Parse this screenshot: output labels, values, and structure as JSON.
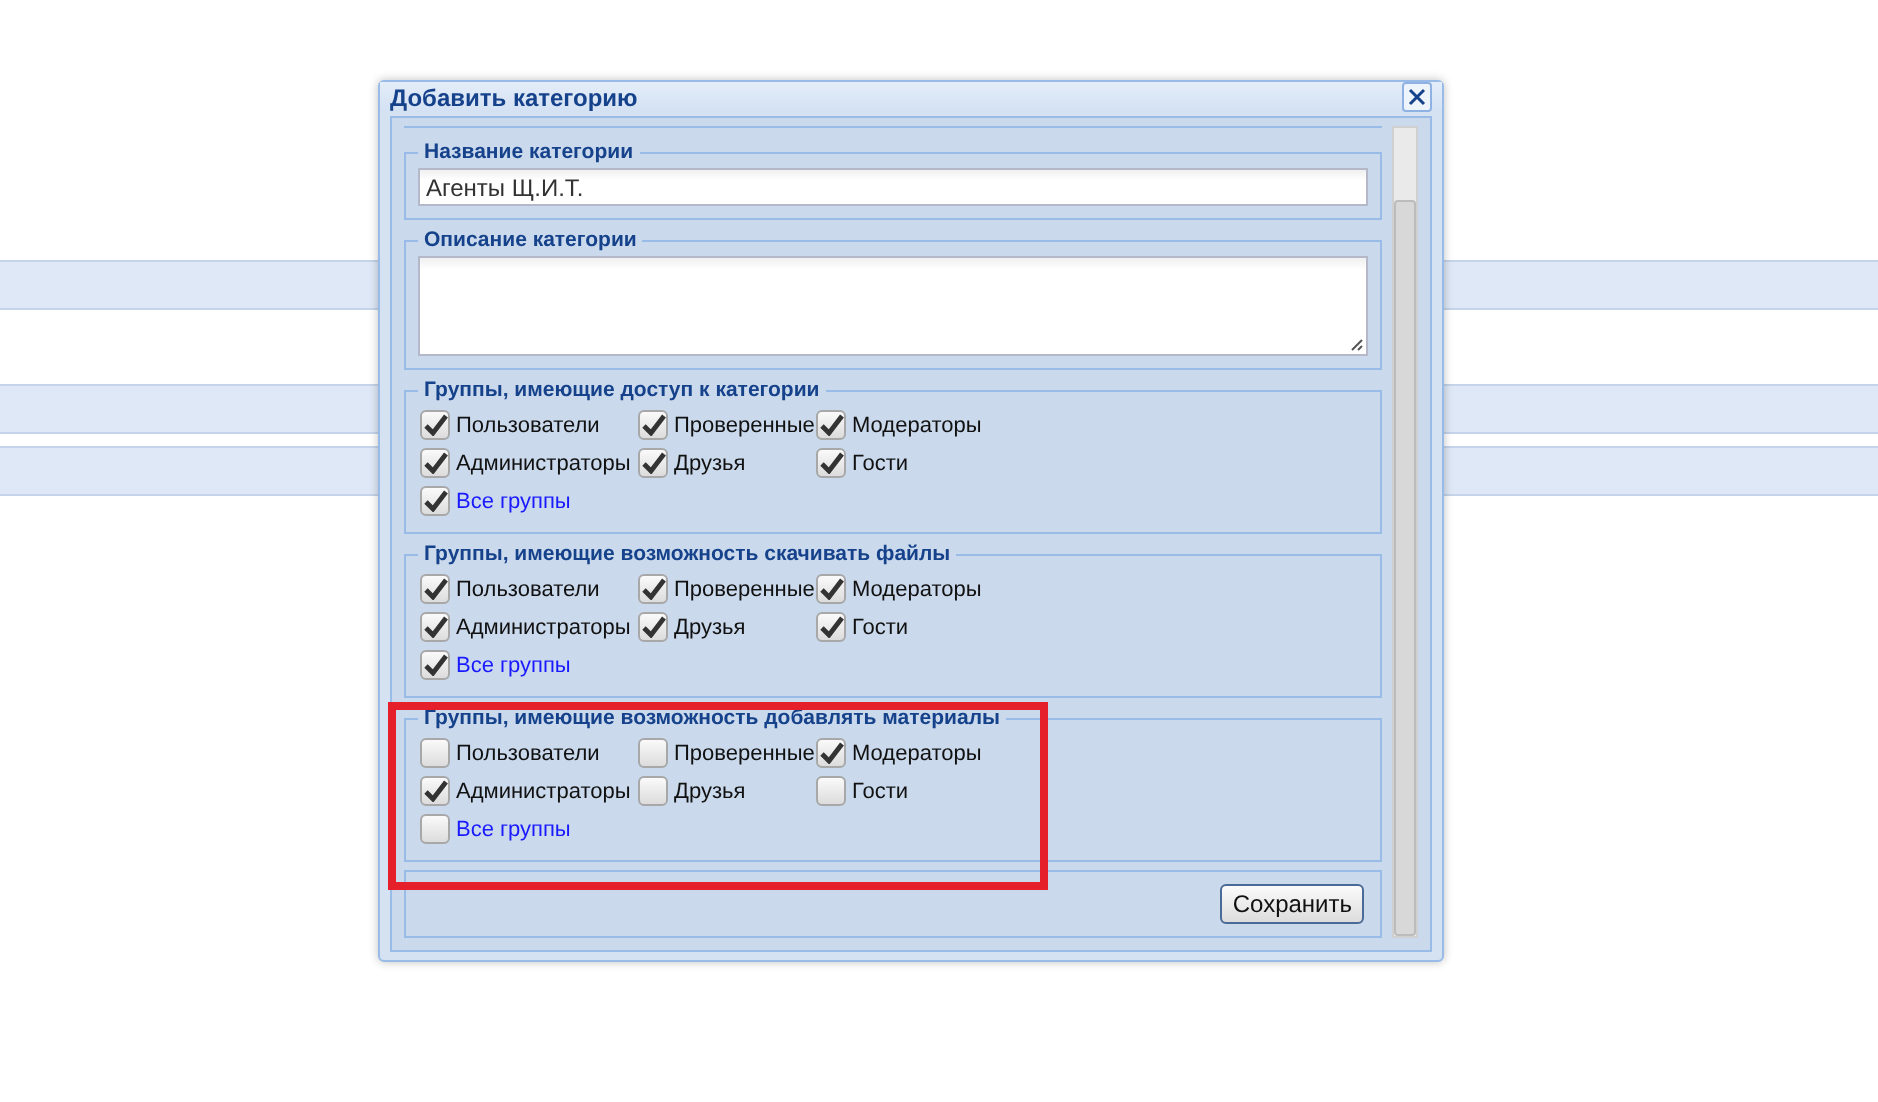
{
  "window": {
    "title": "Добавить категорию"
  },
  "sections": [
    {
      "kind": "text_field",
      "title": "Название категории",
      "value": "Агенты Щ.И.Т."
    },
    {
      "kind": "text_area",
      "title": "Описание категории"
    },
    {
      "kind": "checkbox_group",
      "title": "Группы, имеющие доступ к категории",
      "highlighted": false,
      "items": [
        {
          "kind": "group",
          "label": "Пользователи",
          "checked": true
        },
        {
          "kind": "group",
          "label": "Проверенные",
          "checked": true
        },
        {
          "kind": "group",
          "label": "Модераторы",
          "checked": true
        },
        {
          "kind": "group",
          "label": "Администраторы",
          "checked": true
        },
        {
          "kind": "group",
          "label": "Друзья",
          "checked": true
        },
        {
          "kind": "group",
          "label": "Гости",
          "checked": true
        },
        {
          "kind": "all",
          "label": "Все группы",
          "checked": true
        }
      ]
    },
    {
      "kind": "checkbox_group",
      "title": "Группы, имеющие возможность скачивать файлы",
      "highlighted": false,
      "items": [
        {
          "kind": "group",
          "label": "Пользователи",
          "checked": true
        },
        {
          "kind": "group",
          "label": "Проверенные",
          "checked": true
        },
        {
          "kind": "group",
          "label": "Модераторы",
          "checked": true
        },
        {
          "kind": "group",
          "label": "Администраторы",
          "checked": true
        },
        {
          "kind": "group",
          "label": "Друзья",
          "checked": true
        },
        {
          "kind": "group",
          "label": "Гости",
          "checked": true
        },
        {
          "kind": "all",
          "label": "Все группы",
          "checked": true
        }
      ]
    },
    {
      "kind": "checkbox_group",
      "title": "Группы, имеющие возможность добавлять материалы",
      "highlighted": true,
      "items": [
        {
          "kind": "group",
          "label": "Пользователи",
          "checked": false
        },
        {
          "kind": "group",
          "label": "Проверенные",
          "checked": false
        },
        {
          "kind": "group",
          "label": "Модераторы",
          "checked": true
        },
        {
          "kind": "group",
          "label": "Администраторы",
          "checked": true
        },
        {
          "kind": "group",
          "label": "Друзья",
          "checked": false
        },
        {
          "kind": "group",
          "label": "Гости",
          "checked": false
        },
        {
          "kind": "all",
          "label": "Все группы",
          "checked": false
        }
      ]
    }
  ],
  "buttons": [
    "Сохранить"
  ]
}
